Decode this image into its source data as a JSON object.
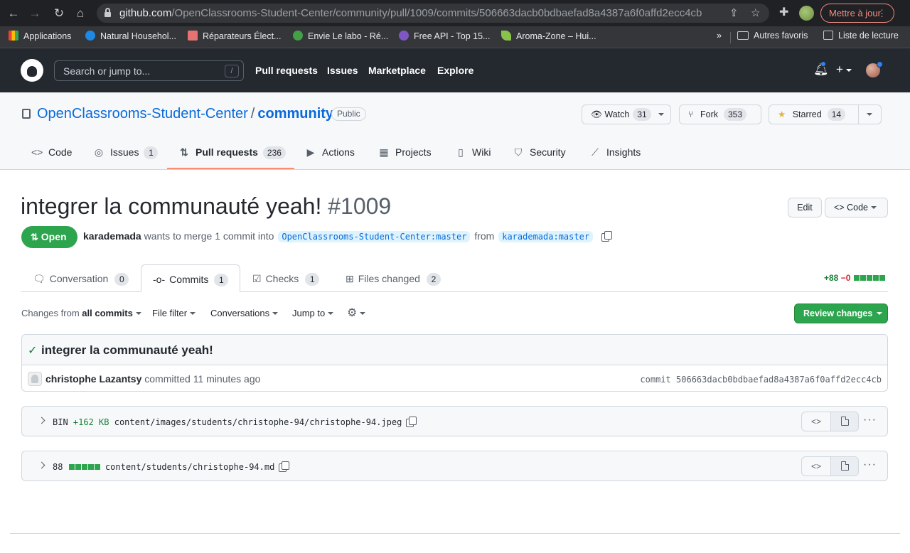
{
  "browser": {
    "url_host": "github.com",
    "url_path": "/OpenClassrooms-Student-Center/community/pull/1009/commits/506663dacb0bdbaefad8a4387a6f0affd2ecc4cb",
    "update_label": "Mettre à jour",
    "bookmarks": [
      {
        "label": "Applications",
        "color": "#e8eaed"
      },
      {
        "label": "Natural Househol...",
        "color": "#1e88e5"
      },
      {
        "label": "Réparateurs Élect...",
        "color": "#e57373"
      },
      {
        "label": "Envie Le labo - Ré...",
        "color": "#43a047"
      },
      {
        "label": "Free API - Top 15...",
        "color": "#7e57c2"
      },
      {
        "label": "Aroma-Zone – Hui...",
        "color": "#8bc34a"
      }
    ],
    "more_bookmarks": "»",
    "other_bookmarks": "Autres favoris",
    "reading_list": "Liste de lecture"
  },
  "github": {
    "search_placeholder": "Search or jump to...",
    "search_key": "/",
    "nav": [
      "Pull requests",
      "Issues",
      "Marketplace",
      "Explore"
    ]
  },
  "repo": {
    "owner": "OpenClassrooms-Student-Center",
    "name": "community",
    "visibility": "Public",
    "watch_label": "Watch",
    "watch_count": "31",
    "fork_label": "Fork",
    "fork_count": "353",
    "star_label": "Starred",
    "star_count": "14",
    "tabs": [
      {
        "label": "Code",
        "count": ""
      },
      {
        "label": "Issues",
        "count": "1"
      },
      {
        "label": "Pull requests",
        "count": "236"
      },
      {
        "label": "Actions",
        "count": ""
      },
      {
        "label": "Projects",
        "count": ""
      },
      {
        "label": "Wiki",
        "count": ""
      },
      {
        "label": "Security",
        "count": ""
      },
      {
        "label": "Insights",
        "count": ""
      }
    ]
  },
  "pr": {
    "title": "integrer la communauté yeah!",
    "number": "#1009",
    "edit_label": "Edit",
    "code_label": "Code",
    "state": "Open",
    "author": "karademada",
    "merge_text": "wants to merge 1 commit into",
    "base_branch": "OpenClassrooms-Student-Center:master",
    "from_text": "from",
    "head_branch": "karademada:master",
    "tabs": [
      {
        "label": "Conversation",
        "count": "0"
      },
      {
        "label": "Commits",
        "count": "1"
      },
      {
        "label": "Checks",
        "count": "1"
      },
      {
        "label": "Files changed",
        "count": "2"
      }
    ],
    "additions": "+88",
    "deletions": "−0",
    "toolbar": {
      "changes_from_prefix": "Changes from",
      "changes_from_value": "all commits",
      "file_filter": "File filter",
      "conversations": "Conversations",
      "jump_to": "Jump to",
      "review_changes": "Review changes"
    }
  },
  "commit": {
    "message": "integrer la communauté yeah!",
    "author": "christophe Lazantsy",
    "committed_text": "committed 11 minutes ago",
    "sha_label": "commit",
    "sha": "506663dacb0bdbaefad8a4387a6f0affd2ecc4cb"
  },
  "files": [
    {
      "stat_prefix": "BIN",
      "stat_change": "+162 KB",
      "path": "content/images/students/christophe-94/christophe-94.jpeg"
    },
    {
      "stat_prefix": "88",
      "stat_change": "",
      "path": "content/students/christophe-94.md"
    }
  ]
}
